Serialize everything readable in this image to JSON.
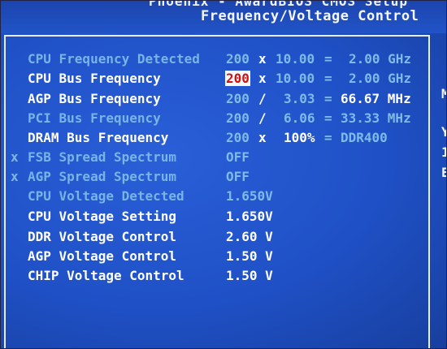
{
  "header": {
    "line1": "Phoenix - AwardBIOS CMOS Setup",
    "title": "Frequency/Voltage Control"
  },
  "right_panel": [
    "M",
    "Y",
    "1",
    "E"
  ],
  "rows": [
    {
      "label": "CPU Frequency Detected",
      "style": "dim",
      "c1": "200",
      "op1": "x",
      "c2": "10.00",
      "eq": "=",
      "res": "2.00 GHz"
    },
    {
      "label": "CPU Bus Frequency",
      "style": "white",
      "c1": "200",
      "op1": "x",
      "c2": "10.00",
      "eq": "=",
      "res": "2.00 GHz"
    },
    {
      "label": "AGP Bus Frequency",
      "style": "white",
      "c1": "200",
      "op1": "/",
      "c2": "3.03",
      "eq": "=",
      "res": "66.67 MHz"
    },
    {
      "label": "PCI Bus Frequency",
      "style": "dim",
      "c1": "200",
      "op1": "/",
      "c2": "6.06",
      "eq": "=",
      "res": "33.33 MHz"
    },
    {
      "label": "DRAM Bus Frequency",
      "style": "white",
      "c1": "200",
      "op1": "x",
      "c2": "100%",
      "eq": "=",
      "res": "DDR400"
    },
    {
      "label": "FSB Spread Spectrum",
      "style": "dim",
      "x": "x",
      "value": "OFF"
    },
    {
      "label": "AGP Spread Spectrum",
      "style": "dim",
      "x": "x",
      "value": "OFF"
    },
    {
      "label": "CPU Voltage Detected",
      "style": "dim",
      "value": "1.650V"
    },
    {
      "label": "CPU Voltage Setting",
      "style": "white",
      "value": "1.650V"
    },
    {
      "label": "DDR Voltage Control",
      "style": "white",
      "value": "2.60 V"
    },
    {
      "label": "AGP Voltage Control",
      "style": "white",
      "value": "1.50 V"
    },
    {
      "label": "CHIP Voltage Control",
      "style": "white",
      "value": "1.50 V"
    }
  ],
  "selected_field": "CPU Bus Frequency multiplier base 200",
  "colors": {
    "background": "#1f50c6",
    "dim_text": "#78b4e4",
    "bright_text": "#ffffff",
    "selection_bg": "#f8f8f8",
    "selection_fg": "#d11212"
  }
}
